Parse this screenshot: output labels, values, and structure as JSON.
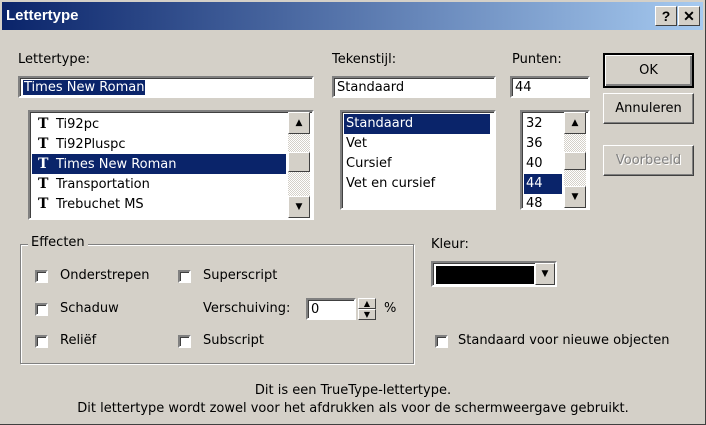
{
  "title": "Lettertype",
  "titlebar": {
    "help": "?",
    "close": "✕"
  },
  "font": {
    "label": "Lettertype:",
    "value": "Times New Roman",
    "items": [
      "Ti92pc",
      "Ti92Pluspc",
      "Times New Roman",
      "Transportation",
      "Trebuchet MS"
    ],
    "selected_index": 2,
    "item_icon": "truetype-icon"
  },
  "style": {
    "label": "Tekenstijl:",
    "value": "Standaard",
    "items": [
      "Standaard",
      "Vet",
      "Cursief",
      "Vet en cursief"
    ],
    "selected_index": 0
  },
  "size": {
    "label": "Punten:",
    "value": "44",
    "items": [
      "32",
      "36",
      "40",
      "44",
      "48"
    ],
    "selected_index": 3
  },
  "buttons": {
    "ok": "OK",
    "cancel": "Annuleren",
    "preview": "Voorbeeld"
  },
  "effects": {
    "label": "Effecten",
    "underline": "Onderstrepen",
    "superscript": "Superscript",
    "shadow": "Schaduw",
    "offset_label": "Verschuiving:",
    "offset_value": "0",
    "offset_unit": "%",
    "emboss": "Reliëf",
    "subscript": "Subscript"
  },
  "color": {
    "label": "Kleur:",
    "value_hex": "#000000"
  },
  "default_checkbox": "Standaard voor nieuwe objecten",
  "info": {
    "line1": "Dit is een TrueType-lettertype.",
    "line2": "Dit lettertype wordt zowel voor het afdrukken als voor de schermweergave gebruikt."
  }
}
